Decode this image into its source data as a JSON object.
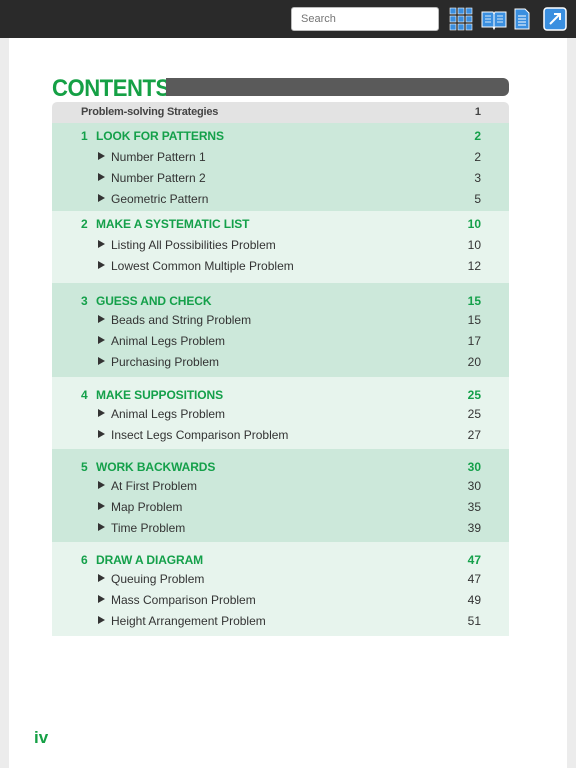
{
  "toolbar": {
    "search_placeholder": "Search",
    "icons": [
      "grid-icon",
      "book-icon",
      "document-icon",
      "external-link-icon"
    ],
    "accent": "#2f86d6"
  },
  "contents": {
    "title": "CONTENTS",
    "strategies": {
      "label": "Problem-solving Strategies",
      "page": "1"
    },
    "sections": [
      {
        "num": "1",
        "title": "LOOK FOR PATTERNS",
        "page": "2",
        "items": [
          {
            "label": "Number Pattern 1",
            "page": "2"
          },
          {
            "label": "Number Pattern 2",
            "page": "3"
          },
          {
            "label": "Geometric Pattern",
            "page": "5"
          }
        ]
      },
      {
        "num": "2",
        "title": "MAKE A SYSTEMATIC LIST",
        "page": "10",
        "items": [
          {
            "label": "Listing All Possibilities Problem",
            "page": "10"
          },
          {
            "label": "Lowest Common Multiple Problem",
            "page": "12"
          }
        ]
      },
      {
        "num": "3",
        "title": "GUESS AND CHECK",
        "page": "15",
        "items": [
          {
            "label": "Beads and String Problem",
            "page": "15"
          },
          {
            "label": "Animal Legs Problem",
            "page": "17"
          },
          {
            "label": "Purchasing Problem",
            "page": "20"
          }
        ]
      },
      {
        "num": "4",
        "title": "MAKE SUPPOSITIONS",
        "page": "25",
        "items": [
          {
            "label": "Animal Legs Problem",
            "page": "25"
          },
          {
            "label": "Insect Legs Comparison Problem",
            "page": "27"
          }
        ]
      },
      {
        "num": "5",
        "title": "WORK BACKWARDS",
        "page": "30",
        "items": [
          {
            "label": "At First Problem",
            "page": "30"
          },
          {
            "label": "Map Problem",
            "page": "35"
          },
          {
            "label": "Time Problem",
            "page": "39"
          }
        ]
      },
      {
        "num": "6",
        "title": "DRAW A DIAGRAM",
        "page": "47",
        "items": [
          {
            "label": "Queuing Problem",
            "page": "47"
          },
          {
            "label": "Mass Comparison Problem",
            "page": "49"
          },
          {
            "label": "Height Arrangement Problem",
            "page": "51"
          }
        ]
      }
    ]
  },
  "page_number": "iv",
  "colors": {
    "green": "#15a045",
    "section_dark": "#cce8da",
    "section_light": "#e7f4ed"
  }
}
